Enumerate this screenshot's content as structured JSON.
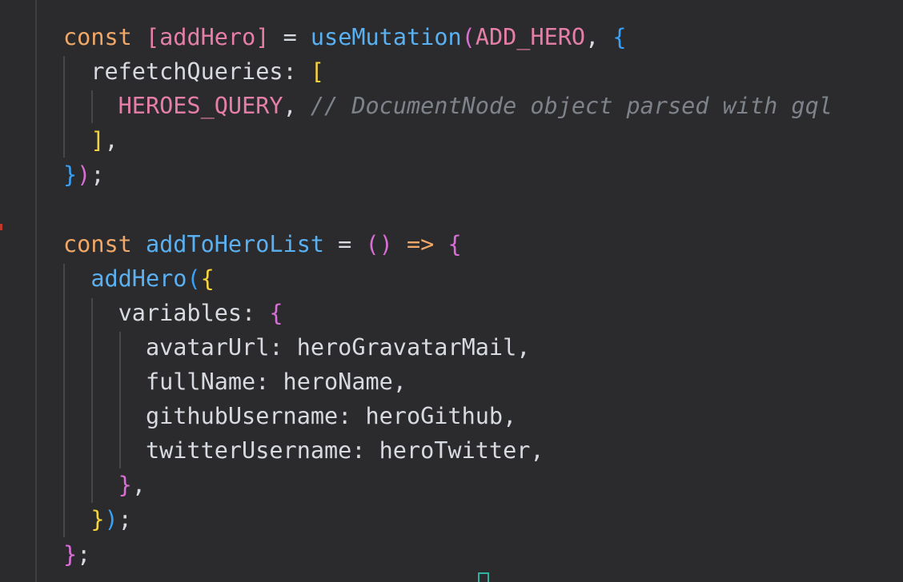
{
  "editor": {
    "lines": [
      {
        "tokens": [
          {
            "text": "const ",
            "cls": "kw"
          },
          {
            "text": "[",
            "cls": "var"
          },
          {
            "text": "addHero",
            "cls": "var"
          },
          {
            "text": "]",
            "cls": "var"
          },
          {
            "text": " = ",
            "cls": "op"
          },
          {
            "text": "useMutation",
            "cls": "fn"
          },
          {
            "text": "(",
            "cls": "b2"
          },
          {
            "text": "ADD_HERO",
            "cls": "var"
          },
          {
            "text": ", ",
            "cls": "plain"
          },
          {
            "text": "{",
            "cls": "b3"
          }
        ]
      },
      {
        "tokens": [
          {
            "text": "  refetchQueries: ",
            "cls": "plain"
          },
          {
            "text": "[",
            "cls": "b1"
          }
        ]
      },
      {
        "tokens": [
          {
            "text": "    ",
            "cls": "plain"
          },
          {
            "text": "HEROES_QUERY",
            "cls": "var"
          },
          {
            "text": ", ",
            "cls": "plain"
          },
          {
            "text": "// DocumentNode object parsed with gql",
            "cls": "cm"
          }
        ]
      },
      {
        "tokens": [
          {
            "text": "  ",
            "cls": "plain"
          },
          {
            "text": "]",
            "cls": "b1"
          },
          {
            "text": ",",
            "cls": "plain"
          }
        ]
      },
      {
        "tokens": [
          {
            "text": "}",
            "cls": "b3"
          },
          {
            "text": ")",
            "cls": "b2"
          },
          {
            "text": ";",
            "cls": "plain"
          }
        ]
      },
      {
        "tokens": []
      },
      {
        "tokens": [
          {
            "text": "const ",
            "cls": "kw"
          },
          {
            "text": "addToHeroList",
            "cls": "fn"
          },
          {
            "text": " = ",
            "cls": "op"
          },
          {
            "text": "()",
            "cls": "b2"
          },
          {
            "text": " => ",
            "cls": "kw"
          },
          {
            "text": "{",
            "cls": "b2"
          }
        ]
      },
      {
        "tokens": [
          {
            "text": "  ",
            "cls": "plain"
          },
          {
            "text": "addHero",
            "cls": "fn"
          },
          {
            "text": "(",
            "cls": "b3"
          },
          {
            "text": "{",
            "cls": "b1"
          }
        ]
      },
      {
        "tokens": [
          {
            "text": "    variables: ",
            "cls": "plain"
          },
          {
            "text": "{",
            "cls": "b2"
          }
        ]
      },
      {
        "tokens": [
          {
            "text": "      avatarUrl: heroGravatarMail,",
            "cls": "plain"
          }
        ]
      },
      {
        "tokens": [
          {
            "text": "      fullName: heroName,",
            "cls": "plain"
          }
        ]
      },
      {
        "tokens": [
          {
            "text": "      githubUsername: heroGithub,",
            "cls": "plain"
          }
        ]
      },
      {
        "tokens": [
          {
            "text": "      twitterUsername: heroTwitter,",
            "cls": "plain"
          }
        ]
      },
      {
        "tokens": [
          {
            "text": "    ",
            "cls": "plain"
          },
          {
            "text": "}",
            "cls": "b2"
          },
          {
            "text": ",",
            "cls": "plain"
          }
        ]
      },
      {
        "tokens": [
          {
            "text": "  ",
            "cls": "plain"
          },
          {
            "text": "}",
            "cls": "b1"
          },
          {
            "text": ")",
            "cls": "b3"
          },
          {
            "text": ";",
            "cls": "plain"
          }
        ]
      },
      {
        "tokens": [
          {
            "text": "}",
            "cls": "b2"
          },
          {
            "text": ";",
            "cls": "plain"
          }
        ]
      }
    ]
  },
  "colors": {
    "background": "#2b2b2d",
    "keyword": "#f0a868",
    "variable": "#e67fa8",
    "function": "#5ab0f0",
    "comment": "#7e828a",
    "bracket_yellow": "#f5d33c",
    "bracket_pink": "#d86ed6",
    "bracket_blue": "#3aa0f5"
  }
}
